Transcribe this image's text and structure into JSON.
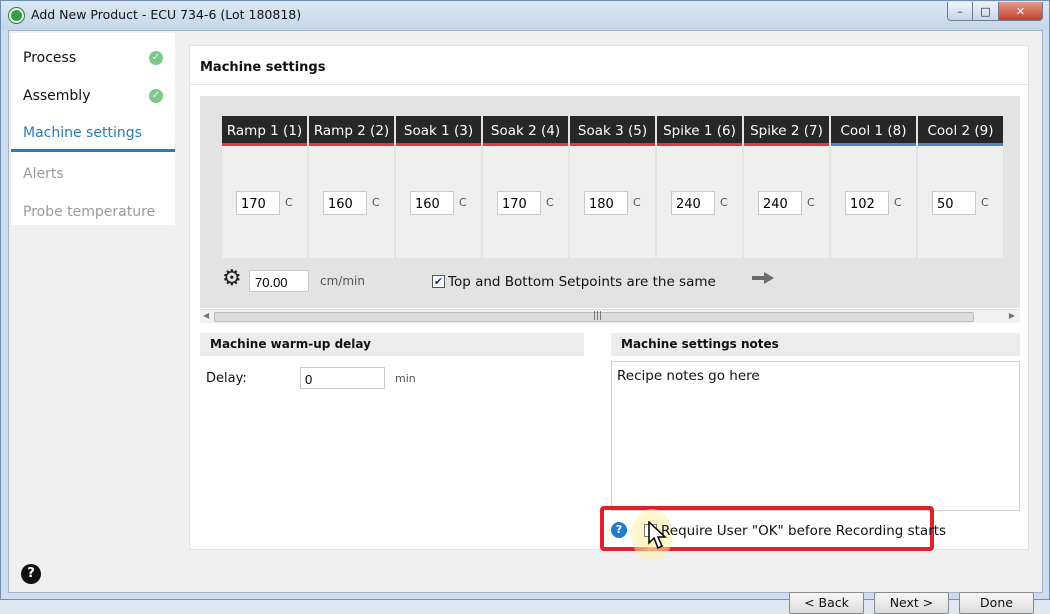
{
  "window": {
    "title": "Add New Product - ECU 734-6 (Lot 180818)",
    "controls": {
      "minimize": "–",
      "maximize": "□",
      "close": "✕"
    }
  },
  "sidebar": {
    "items": [
      {
        "label": "Process",
        "state": "done"
      },
      {
        "label": "Assembly",
        "state": "done"
      },
      {
        "label": "Machine settings",
        "state": "active"
      },
      {
        "label": "Alerts",
        "state": "disabled"
      },
      {
        "label": "Probe temperature",
        "state": "disabled"
      }
    ],
    "check_glyph": "✓"
  },
  "main": {
    "title": "Machine settings",
    "zones": [
      {
        "label": "Ramp 1 (1)",
        "value": "170",
        "unit": "C",
        "type": "heat"
      },
      {
        "label": "Ramp 2 (2)",
        "value": "160",
        "unit": "C",
        "type": "heat"
      },
      {
        "label": "Soak 1 (3)",
        "value": "160",
        "unit": "C",
        "type": "heat"
      },
      {
        "label": "Soak 2 (4)",
        "value": "170",
        "unit": "C",
        "type": "heat"
      },
      {
        "label": "Soak 3 (5)",
        "value": "180",
        "unit": "C",
        "type": "heat"
      },
      {
        "label": "Spike 1 (6)",
        "value": "240",
        "unit": "C",
        "type": "heat"
      },
      {
        "label": "Spike 2 (7)",
        "value": "240",
        "unit": "C",
        "type": "heat"
      },
      {
        "label": "Cool 1 (8)",
        "value": "102",
        "unit": "C",
        "type": "cool"
      },
      {
        "label": "Cool 2 (9)",
        "value": "50",
        "unit": "C",
        "type": "cool"
      }
    ],
    "conveyor": {
      "speed": "70.00",
      "unit": "cm/min"
    },
    "same_setpoints": {
      "label": "Top and Bottom Setpoints are the same",
      "checked": true
    },
    "warmup": {
      "title": "Machine warm-up delay",
      "label": "Delay:",
      "value": "0",
      "unit": "min"
    },
    "notes": {
      "title": "Machine settings notes",
      "value": "Recipe notes go here"
    },
    "require_ok": {
      "label": "Require User \"OK\" before Recording starts",
      "checked": false
    },
    "info_glyph": "?",
    "colors": {
      "heat_accent": "#e0383d",
      "cool_accent": "#4d86c8",
      "highlight": "#e0202b"
    }
  },
  "footer": {
    "help_glyph": "?",
    "back": "< Back",
    "next": "Next >",
    "done": "Done"
  }
}
